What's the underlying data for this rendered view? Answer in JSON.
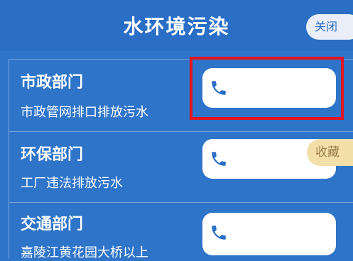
{
  "header": {
    "title": "水环境污染",
    "close_label": "关闭"
  },
  "departments": [
    {
      "name": "市政部门",
      "desc": "市政管网排口排放污水",
      "phone": ""
    },
    {
      "name": "环保部门",
      "desc": "工厂违法排放污水",
      "phone": ""
    },
    {
      "name": "交通部门",
      "desc": "嘉陵江黄花园大桥以上",
      "phone": ""
    }
  ],
  "collect_label": "收藏",
  "colors": {
    "background": "#2e74c9",
    "highlight": "#e3151d",
    "collect_bg": "#f3dfa8",
    "phone_icon": "#2a6ec6"
  },
  "icons": {
    "phone": "phone-icon"
  }
}
